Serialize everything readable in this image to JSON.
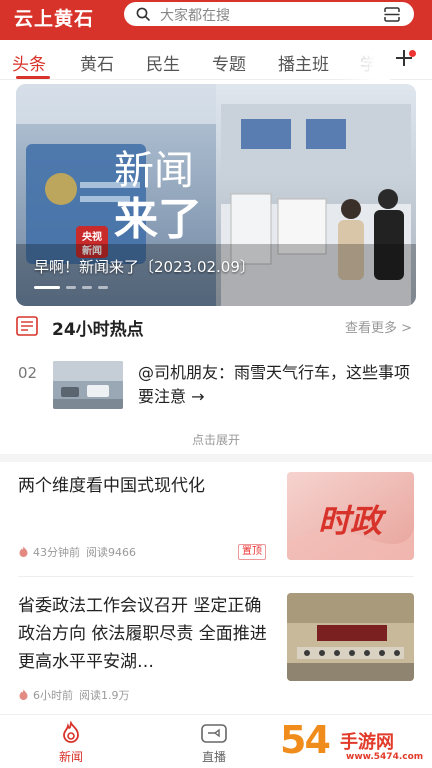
{
  "header": {
    "app_title": "云上黄石",
    "search_placeholder": "大家都在搜",
    "search_icon": "search-icon",
    "scan_icon": "scan-icon"
  },
  "tabs": [
    {
      "label": "头条",
      "active": true
    },
    {
      "label": "黄石"
    },
    {
      "label": "民生"
    },
    {
      "label": "专题"
    },
    {
      "label": "播主班"
    },
    {
      "label": "学"
    }
  ],
  "tabs_add_icon": "plus-icon",
  "banner": {
    "title": "早啊！新闻来了〔2023.02.09〕",
    "overlay_text_1": "新闻",
    "overlay_text_2": "来了",
    "logo_text_1": "央视",
    "logo_text_2": "新闻",
    "slide_count": 4,
    "active_slide": 1
  },
  "hot": {
    "title": "24小时热点",
    "see_more": "查看更多 >",
    "item": {
      "rank": "02",
      "text": "@司机朋友：雨雪天气行车，这些事项要注意 →"
    },
    "expand": "点击展开"
  },
  "news": [
    {
      "title": "两个维度看中国式现代化",
      "time": "43分钟前",
      "reads": "阅读9466",
      "badge": "置顶",
      "thumb_text": "时政"
    },
    {
      "title": "省委政法工作会议召开 坚定正确政治方向 依法履职尽责 全面推进更高水平平安湖…",
      "time": "6小时前",
      "reads": "阅读1.9万"
    }
  ],
  "bottom_nav": [
    {
      "label": "新闻",
      "icon": "flame-icon",
      "active": true
    },
    {
      "label": "直播",
      "icon": "video-icon"
    }
  ],
  "watermark": {
    "number": "54",
    "text": "手游网",
    "url": "www.5474.com"
  },
  "colors": {
    "brand_red": "#d8332b",
    "muted": "#999999"
  }
}
